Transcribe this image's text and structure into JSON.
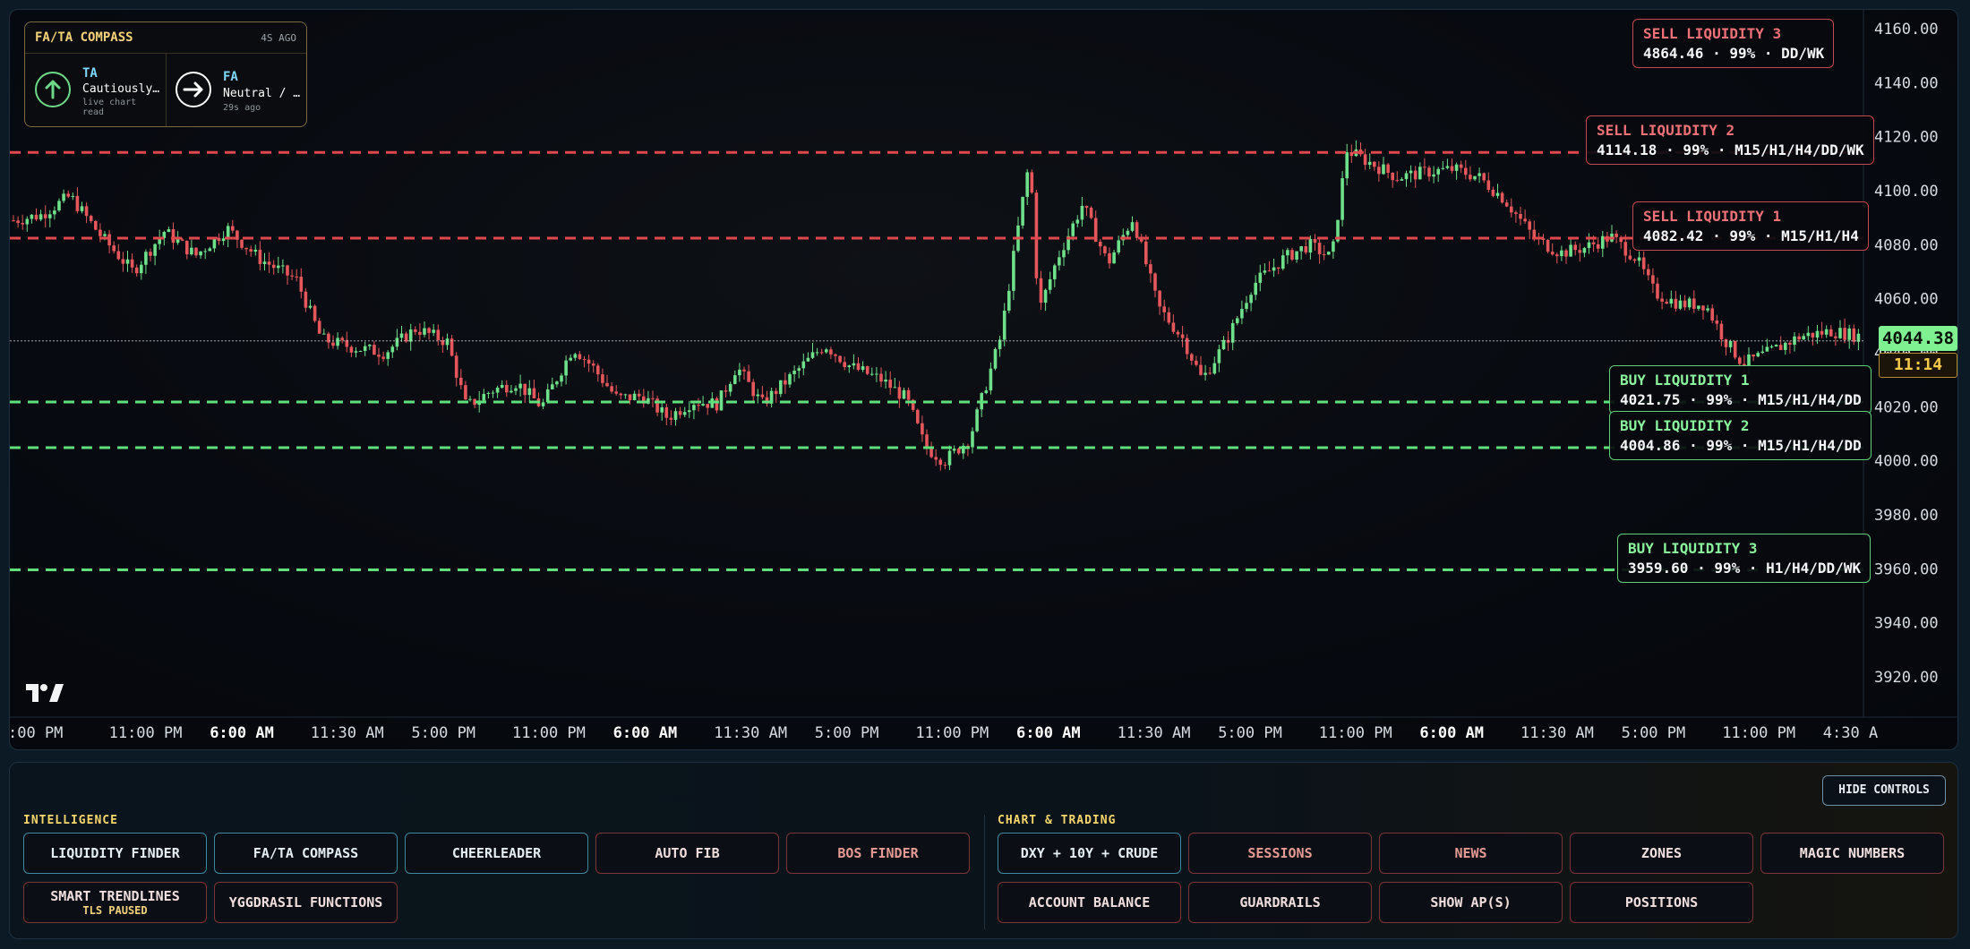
{
  "price_axis": {
    "ticks": [
      "4160.00",
      "4140.00",
      "4120.00",
      "4100.00",
      "4080.00",
      "4060.00",
      "4040.00",
      "4020.00",
      "4000.00",
      "3980.00",
      "3960.00",
      "3940.00",
      "3920.00"
    ],
    "current_price": "4044.38",
    "countdown": "11:14"
  },
  "time_axis": {
    "ticks": [
      {
        "label": ":00 PM",
        "bold": false
      },
      {
        "label": "11:00 PM",
        "bold": false
      },
      {
        "label": "6:00 AM",
        "bold": true
      },
      {
        "label": "11:30 AM",
        "bold": false
      },
      {
        "label": "5:00 PM",
        "bold": false
      },
      {
        "label": "11:00 PM",
        "bold": false
      },
      {
        "label": "6:00 AM",
        "bold": true
      },
      {
        "label": "11:30 AM",
        "bold": false
      },
      {
        "label": "5:00 PM",
        "bold": false
      },
      {
        "label": "11:00 PM",
        "bold": false
      },
      {
        "label": "6:00 AM",
        "bold": true
      },
      {
        "label": "11:30 AM",
        "bold": false
      },
      {
        "label": "5:00 PM",
        "bold": false
      },
      {
        "label": "11:00 PM",
        "bold": false
      },
      {
        "label": "6:00 AM",
        "bold": true
      },
      {
        "label": "11:30 AM",
        "bold": false
      },
      {
        "label": "5:00 PM",
        "bold": false
      },
      {
        "label": "11:00 PM",
        "bold": false
      },
      {
        "label": "4:30 A",
        "bold": false
      }
    ]
  },
  "liquidity": {
    "sell": [
      {
        "title": "SELL LIQUIDITY 3",
        "detail": "4864.46 · 99% · DD/WK",
        "price": 4164.46
      },
      {
        "title": "SELL LIQUIDITY 2",
        "detail": "4114.18 · 99% · M15/H1/H4/DD/WK",
        "price": 4114.18
      },
      {
        "title": "SELL LIQUIDITY 1",
        "detail": "4082.42 · 99% · M15/H1/H4",
        "price": 4082.42
      }
    ],
    "buy": [
      {
        "title": "BUY LIQUIDITY 1",
        "detail": "4021.75 · 99% · M15/H1/H4/DD",
        "price": 4021.75
      },
      {
        "title": "BUY LIQUIDITY 2",
        "detail": "4004.86 · 99% · M15/H1/H4/DD",
        "price": 4004.86
      },
      {
        "title": "BUY LIQUIDITY 3",
        "detail": "3959.60 · 99% · H1/H4/DD/WK",
        "price": 3959.6
      }
    ]
  },
  "compass": {
    "title": "FA/TA COMPASS",
    "age": "4S AGO",
    "ta": {
      "label": "TA",
      "value": "Cautiously…",
      "sub": "live chart read",
      "icon": "arrow-up-icon"
    },
    "fa": {
      "label": "FA",
      "value": "Neutral / …",
      "sub": "29s ago",
      "icon": "arrow-right-icon"
    }
  },
  "controls": {
    "hide_label": "HIDE CONTROLS",
    "intelligence_label": "INTELLIGENCE",
    "chart_trading_label": "CHART & TRADING",
    "intelligence_buttons": [
      {
        "label": "LIQUIDITY FINDER"
      },
      {
        "label": "FA/TA COMPASS"
      },
      {
        "label": "CHEERLEADER"
      },
      {
        "label": "AUTO FIB"
      },
      {
        "label": "BOS FINDER"
      },
      {
        "label": "SMART TRENDLINES",
        "sub": "TLS PAUSED"
      },
      {
        "label": "YGGDRASIL FUNCTIONS"
      }
    ],
    "trading_buttons": [
      {
        "label": "DXY + 10Y + CRUDE"
      },
      {
        "label": "SESSIONS"
      },
      {
        "label": "NEWS"
      },
      {
        "label": "ZONES"
      },
      {
        "label": "MAGIC NUMBERS"
      },
      {
        "label": "ACCOUNT BALANCE"
      },
      {
        "label": "GUARDRAILS"
      },
      {
        "label": "SHOW AP(S)"
      },
      {
        "label": "POSITIONS"
      }
    ]
  },
  "colors": {
    "bull": "#6fe08a",
    "bear": "#e5575b",
    "sell_line": "#e0484e",
    "buy_line": "#5fe07a",
    "accent_yellow": "#f6d56a"
  },
  "price_path_anchors": [
    [
      0,
      4089
    ],
    [
      22,
      4091
    ],
    [
      45,
      4098
    ],
    [
      70,
      4083
    ],
    [
      95,
      4070
    ],
    [
      120,
      4085
    ],
    [
      145,
      4076
    ],
    [
      170,
      4086
    ],
    [
      195,
      4075
    ],
    [
      225,
      4067
    ],
    [
      245,
      4045
    ],
    [
      270,
      4042
    ],
    [
      295,
      4040
    ],
    [
      320,
      4049
    ],
    [
      345,
      4044
    ],
    [
      360,
      4020
    ],
    [
      380,
      4026
    ],
    [
      400,
      4029
    ],
    [
      420,
      4020
    ],
    [
      445,
      4042
    ],
    [
      460,
      4035
    ],
    [
      480,
      4023
    ],
    [
      500,
      4024
    ],
    [
      520,
      4016
    ],
    [
      540,
      4022
    ],
    [
      560,
      4021
    ],
    [
      575,
      4035
    ],
    [
      595,
      4021
    ],
    [
      620,
      4032
    ],
    [
      645,
      4043
    ],
    [
      665,
      4035
    ],
    [
      690,
      4030
    ],
    [
      710,
      4023
    ],
    [
      725,
      4005
    ],
    [
      740,
      4000
    ],
    [
      760,
      4008
    ],
    [
      785,
      4046
    ],
    [
      800,
      4090
    ],
    [
      808,
      4112
    ],
    [
      815,
      4055
    ],
    [
      830,
      4075
    ],
    [
      850,
      4095
    ],
    [
      870,
      4073
    ],
    [
      890,
      4090
    ],
    [
      910,
      4057
    ],
    [
      930,
      4045
    ],
    [
      945,
      4030
    ],
    [
      965,
      4045
    ],
    [
      985,
      4065
    ],
    [
      1010,
      4075
    ],
    [
      1030,
      4080
    ],
    [
      1048,
      4075
    ],
    [
      1060,
      4115
    ],
    [
      1080,
      4110
    ],
    [
      1100,
      4105
    ],
    [
      1125,
      4107
    ],
    [
      1145,
      4108
    ],
    [
      1165,
      4105
    ],
    [
      1185,
      4097
    ],
    [
      1210,
      4082
    ],
    [
      1230,
      4077
    ],
    [
      1250,
      4079
    ],
    [
      1270,
      4083
    ],
    [
      1290,
      4075
    ],
    [
      1305,
      4062
    ],
    [
      1325,
      4058
    ],
    [
      1345,
      4058
    ],
    [
      1360,
      4045
    ],
    [
      1375,
      4036
    ],
    [
      1395,
      4040
    ],
    [
      1420,
      4046
    ],
    [
      1445,
      4048
    ],
    [
      1470,
      4046
    ]
  ]
}
